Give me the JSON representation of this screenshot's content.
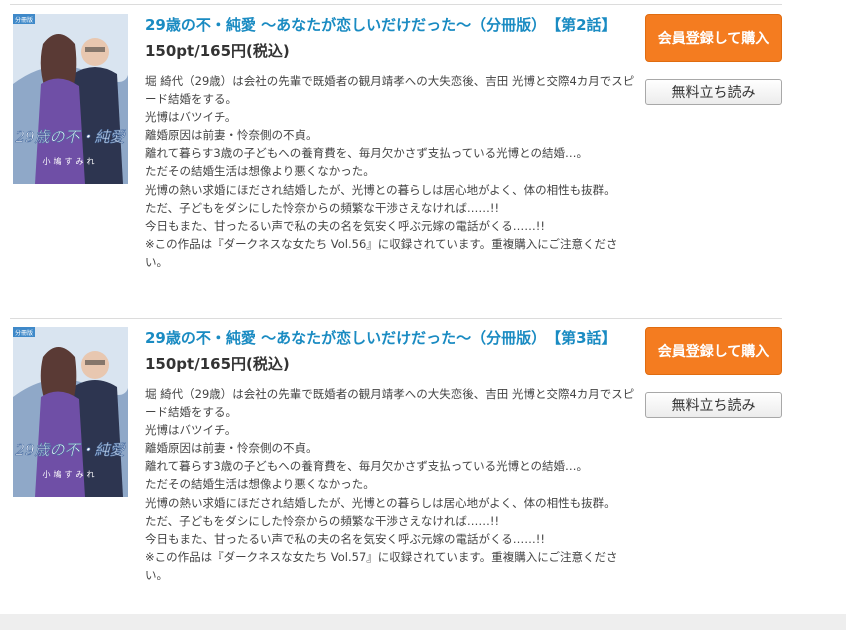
{
  "items": [
    {
      "title": "29歳の不・純愛 ～あなたが恋しいだけだった～（分冊版）　【第2話】",
      "price": "150pt/165円(税込)",
      "buy_label": "会員登録して購入",
      "read_label": "無料立ち読み",
      "cover": {
        "badge": "分冊版",
        "title_text": "29歳の不・純愛",
        "author_text": "小鳩すみれ"
      },
      "description": [
        "堀 綺代（29歳）は会社の先輩で既婚者の観月靖孝への大失恋後、吉田 光博と交際4カ月でスピード結婚をする。",
        "光博はバツイチ。",
        "離婚原因は前妻・怜奈側の不貞。",
        "離れて暮らす3歳の子どもへの養育費を、毎月欠かさず支払っている光博との結婚…。",
        "ただその結婚生活は想像より悪くなかった。",
        "光博の熱い求婚にほだされ結婚したが、光博との暮らしは居心地がよく、体の相性も抜群。",
        "ただ、子どもをダシにした怜奈からの頻繁な干渉さえなければ……!!",
        "今日もまた、甘ったるい声で私の夫の名を気安く呼ぶ元嫁の電話がくる……!!",
        "※この作品は『ダークネスな女たち Vol.56』に収録されています。重複購入にご注意ください。"
      ]
    },
    {
      "title": "29歳の不・純愛 ～あなたが恋しいだけだった～（分冊版）　【第3話】",
      "price": "150pt/165円(税込)",
      "buy_label": "会員登録して購入",
      "read_label": "無料立ち読み",
      "cover": {
        "badge": "分冊版",
        "title_text": "29歳の不・純愛",
        "author_text": "小鳩すみれ"
      },
      "description": [
        "堀 綺代（29歳）は会社の先輩で既婚者の観月靖孝への大失恋後、吉田 光博と交際4カ月でスピード結婚をする。",
        "光博はバツイチ。",
        "離婚原因は前妻・怜奈側の不貞。",
        "離れて暮らす3歳の子どもへの養育費を、毎月欠かさず支払っている光博との結婚…。",
        "ただその結婚生活は想像より悪くなかった。",
        "光博の熱い求婚にほだされ結婚したが、光博との暮らしは居心地がよく、体の相性も抜群。",
        "ただ、子どもをダシにした怜奈からの頻繁な干渉さえなければ……!!",
        "今日もまた、甘ったるい声で私の夫の名を気安く呼ぶ元嫁の電話がくる……!!",
        "※この作品は『ダークネスな女たち Vol.57』に収録されています。重複購入にご注意ください。"
      ]
    }
  ]
}
